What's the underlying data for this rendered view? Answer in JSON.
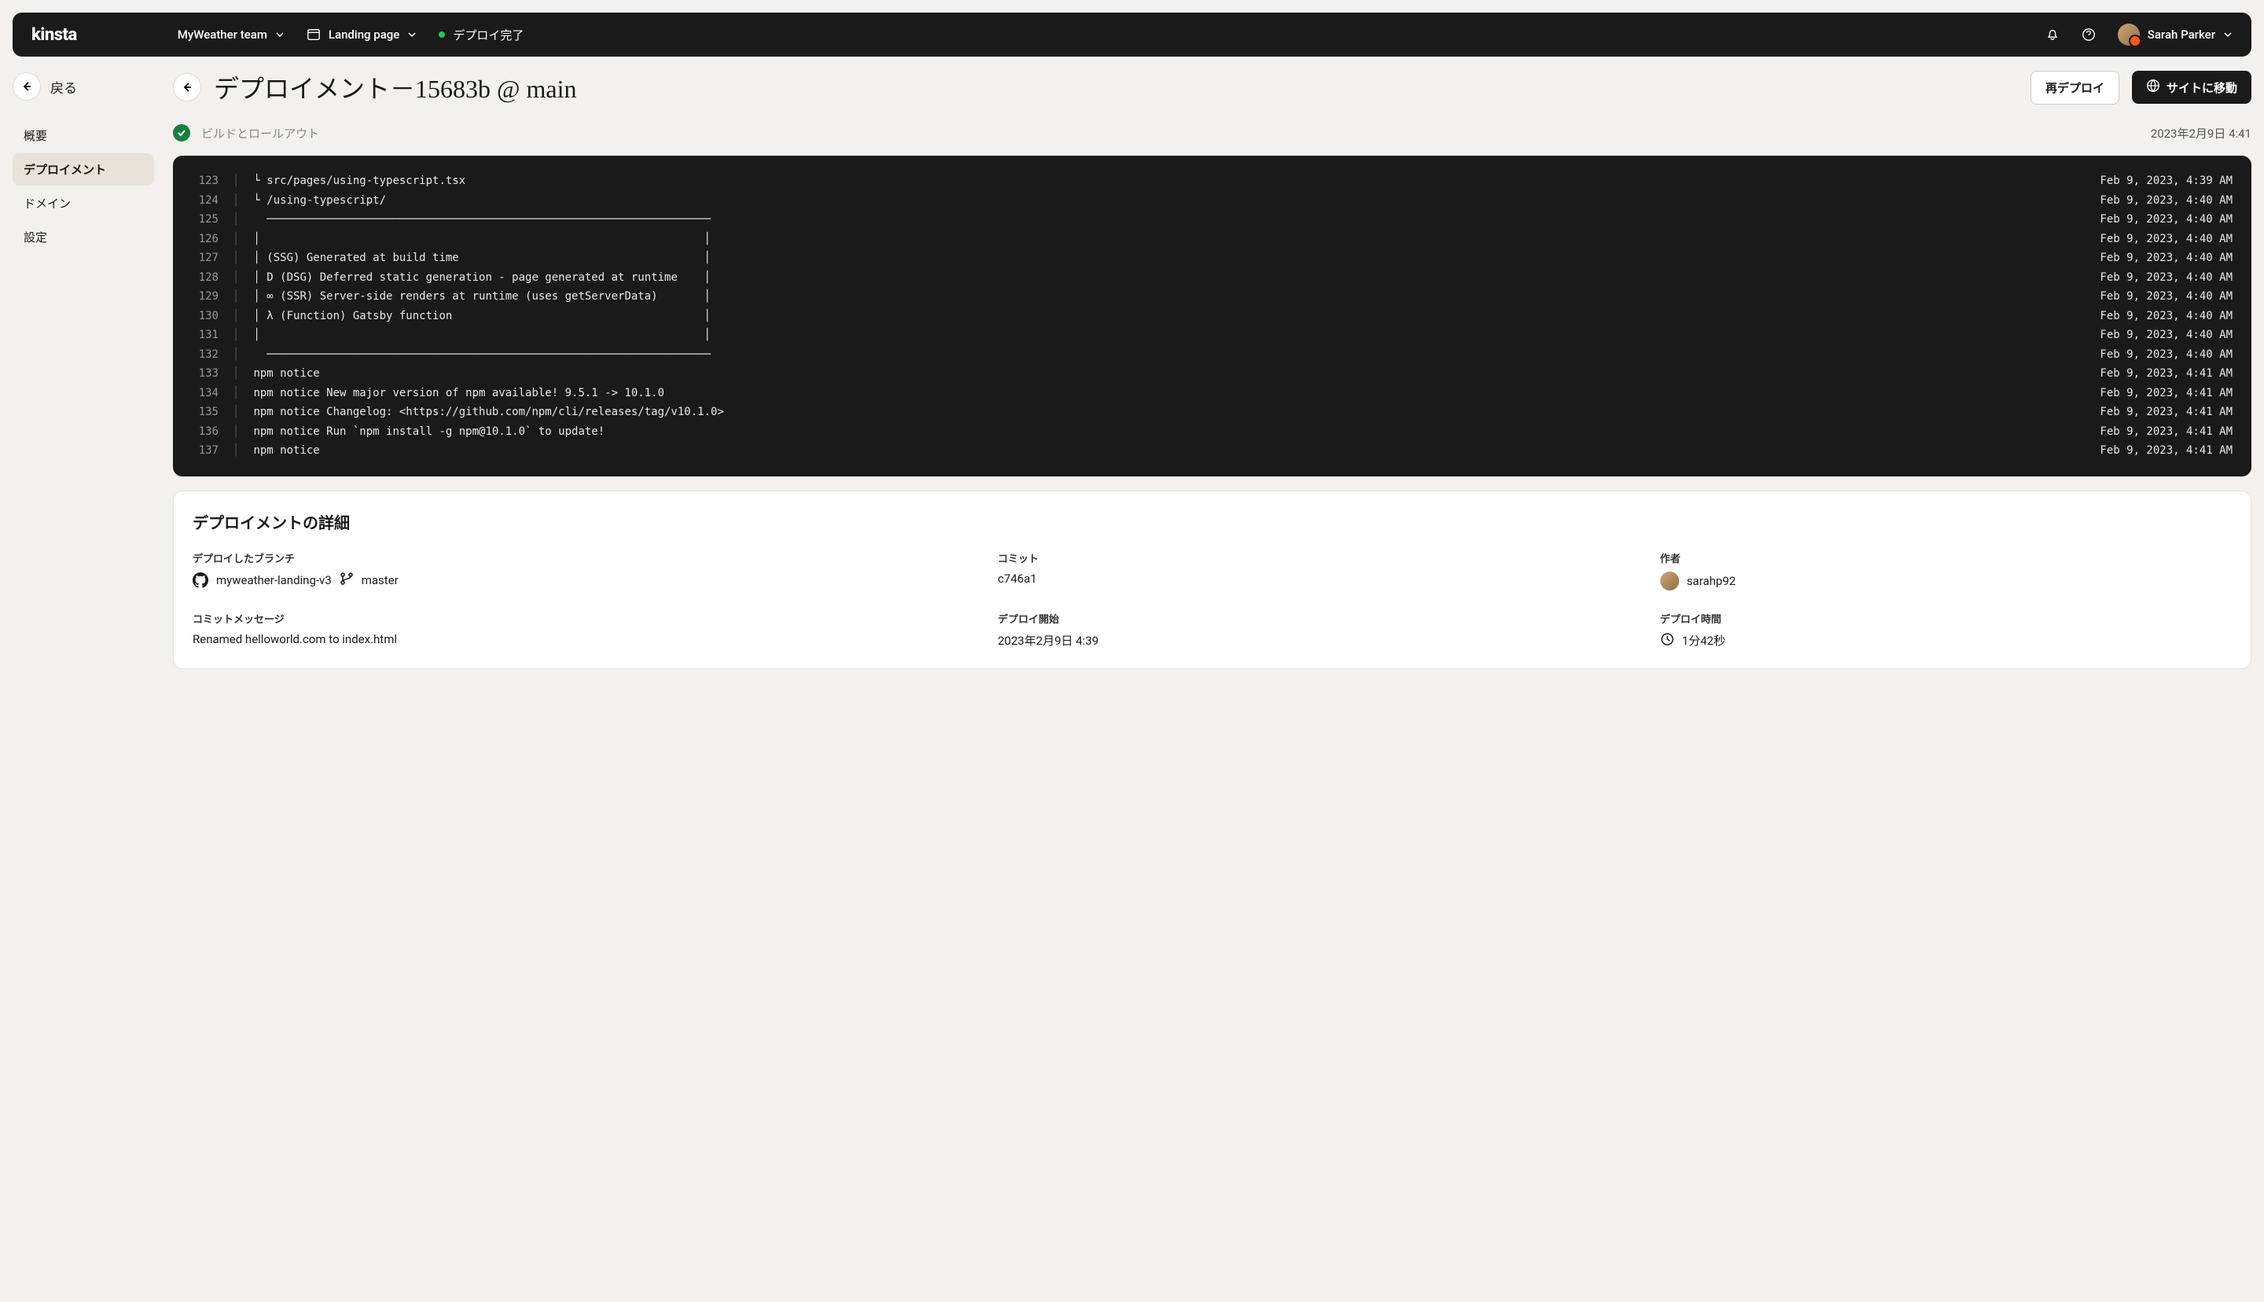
{
  "header": {
    "logo": "kinsta",
    "team": "MyWeather team",
    "project": "Landing page",
    "deploy_status": "デプロイ完了",
    "user_name": "Sarah Parker"
  },
  "sidebar": {
    "back_label": "戻る",
    "items": [
      "概要",
      "デプロイメント",
      "ドメイン",
      "設定"
    ],
    "active_index": 1
  },
  "titlebar": {
    "title": "デプロイメント－15683b @ main",
    "redeploy_label": "再デプロイ",
    "visit_site_label": "サイトに移動"
  },
  "status": {
    "text": "ビルドとロールアウト",
    "time": "2023年2月9日 4:41"
  },
  "logs": [
    {
      "n": "123",
      "msg": "└ src/pages/using-typescript.tsx",
      "ts": "Feb 9, 2023, 4:39 AM"
    },
    {
      "n": "124",
      "msg": "└ /using-typescript/",
      "ts": "Feb 9, 2023, 4:40 AM"
    },
    {
      "n": "125",
      "msg": "  ───────────────────────────────────────────────────────────────────",
      "ts": "Feb 9, 2023, 4:40 AM"
    },
    {
      "n": "126",
      "msg": "│                                                                   │",
      "ts": "Feb 9, 2023, 4:40 AM"
    },
    {
      "n": "127",
      "msg": "│ (SSG) Generated at build time                                     │",
      "ts": "Feb 9, 2023, 4:40 AM"
    },
    {
      "n": "128",
      "msg": "│ D (DSG) Deferred static generation - page generated at runtime    │",
      "ts": "Feb 9, 2023, 4:40 AM"
    },
    {
      "n": "129",
      "msg": "│ ∞ (SSR) Server-side renders at runtime (uses getServerData)       │",
      "ts": "Feb 9, 2023, 4:40 AM"
    },
    {
      "n": "130",
      "msg": "│ λ (Function) Gatsby function                                      │",
      "ts": "Feb 9, 2023, 4:40 AM"
    },
    {
      "n": "131",
      "msg": "│                                                                   │",
      "ts": "Feb 9, 2023, 4:40 AM"
    },
    {
      "n": "132",
      "msg": "  ───────────────────────────────────────────────────────────────────",
      "ts": "Feb 9, 2023, 4:40 AM"
    },
    {
      "n": "133",
      "msg": "npm notice",
      "ts": "Feb 9, 2023, 4:41 AM"
    },
    {
      "n": "134",
      "msg": "npm notice New major version of npm available! 9.5.1 -> 10.1.0",
      "ts": "Feb 9, 2023, 4:41 AM"
    },
    {
      "n": "135",
      "msg": "npm notice Changelog: <https://github.com/npm/cli/releases/tag/v10.1.0>",
      "ts": "Feb 9, 2023, 4:41 AM"
    },
    {
      "n": "136",
      "msg": "npm notice Run `npm install -g npm@10.1.0` to update!",
      "ts": "Feb 9, 2023, 4:41 AM"
    },
    {
      "n": "137",
      "msg": "npm notice",
      "ts": "Feb 9, 2023, 4:41 AM"
    }
  ],
  "details": {
    "heading": "デプロイメントの詳細",
    "branch_label": "デプロイしたブランチ",
    "repo": "myweather-landing-v3",
    "branch": "master",
    "commit_label": "コミット",
    "commit": "c746a1",
    "author_label": "作者",
    "author": "sarahp92",
    "commit_msg_label": "コミットメッセージ",
    "commit_msg": "Renamed helloworld.com to index.html",
    "deploy_start_label": "デプロイ開始",
    "deploy_start": "2023年2月9日 4:39",
    "duration_label": "デプロイ時間",
    "duration": "1分42秒"
  }
}
